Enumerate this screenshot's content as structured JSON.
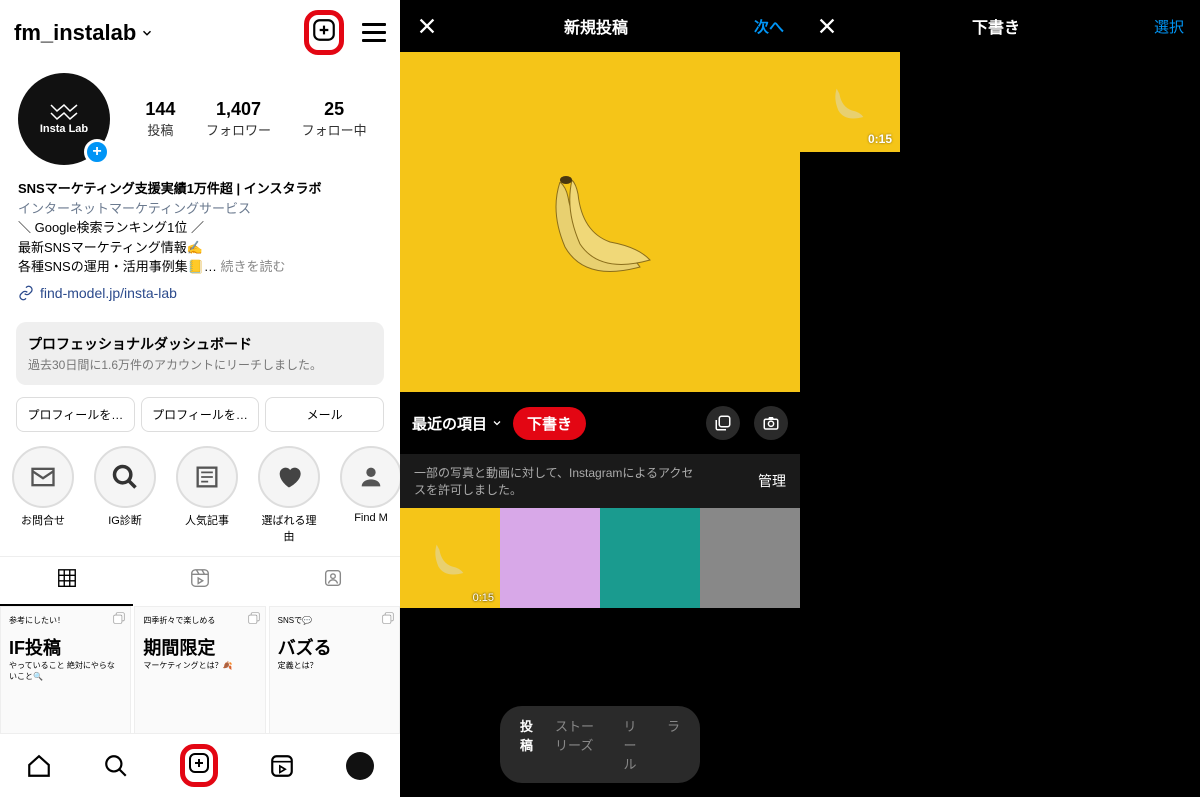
{
  "panel1": {
    "username": "fm_instalab",
    "avatar_text": "Insta Lab",
    "stats": {
      "posts_num": "144",
      "posts_lbl": "投稿",
      "followers_num": "1,407",
      "followers_lbl": "フォロワー",
      "following_num": "25",
      "following_lbl": "フォロー中"
    },
    "bio": {
      "title": "SNSマーケティング支援実績1万件超 | インスタラボ",
      "category": "インターネットマーケティングサービス",
      "line1": "＼ Google検索ランキング1位 ／",
      "line2": "最新SNSマーケティング情報✍️",
      "line3": "各種SNSの運用・活用事例集📒…",
      "more": "続きを読む",
      "link": "find-model.jp/insta-lab"
    },
    "dashboard": {
      "title": "プロフェッショナルダッシュボード",
      "sub": "過去30日間に1.6万件のアカウントにリーチしました。"
    },
    "actions": {
      "b1": "プロフィールを…",
      "b2": "プロフィールを…",
      "b3": "メール"
    },
    "highlights": [
      {
        "label": "お問合せ"
      },
      {
        "label": "IG診断"
      },
      {
        "label": "人気記事"
      },
      {
        "label": "選ばれる理由"
      },
      {
        "label": "Find M"
      }
    ],
    "grid": [
      {
        "top": "参考にしたい！",
        "big": "IF投稿",
        "sub": "やっていること\n絶対にやらないこと🔍"
      },
      {
        "top": "四季折々で楽しめる",
        "big": "期間限定",
        "sub": "マーケティングとは？🍂"
      },
      {
        "top": "SNSで💬",
        "big": "バズる",
        "sub": "定義とは？"
      }
    ]
  },
  "panel2": {
    "title": "新規投稿",
    "next": "次へ",
    "recent": "最近の項目",
    "draft_btn": "下書き",
    "access_msg": "一部の写真と動画に対して、Instagramによるアクセスを許可しました。",
    "manage": "管理",
    "thumb_time": "0:15",
    "modes": {
      "post": "投稿",
      "story": "ストーリーズ",
      "reel": "リール",
      "live": "ラ"
    }
  },
  "panel3": {
    "title": "下書き",
    "select": "選択",
    "time": "0:15"
  }
}
